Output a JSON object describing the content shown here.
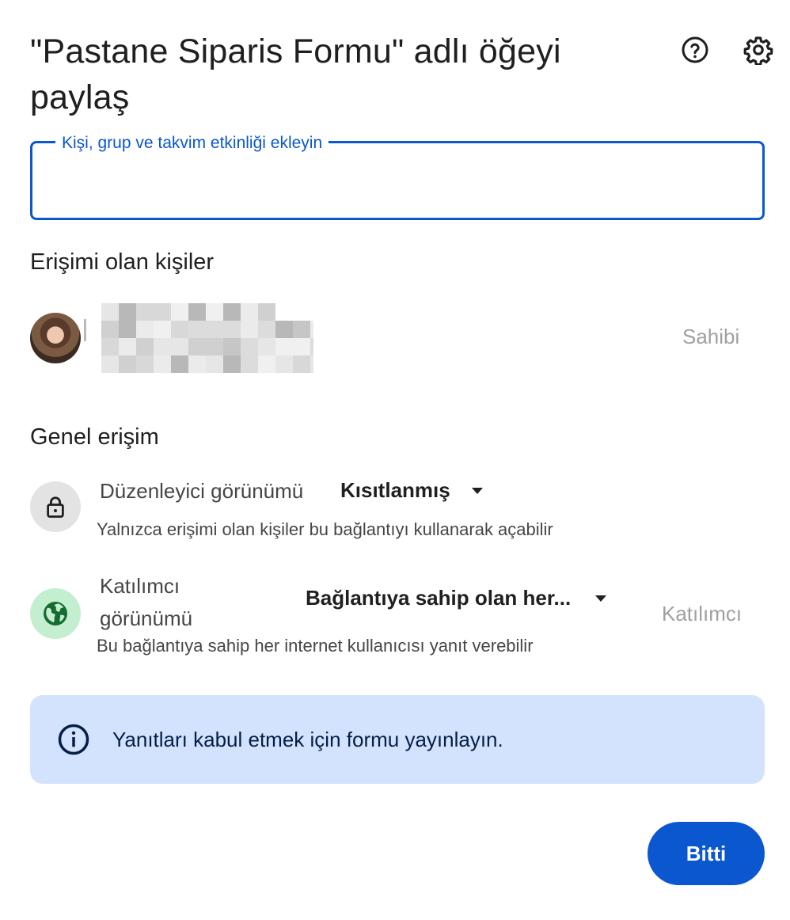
{
  "dialog": {
    "title": "\"Pastane Siparis Formu\" adlı öğeyi paylaş"
  },
  "header_icons": {
    "help": "help-circle-icon",
    "settings": "gear-icon"
  },
  "add_people": {
    "label": "Kişi, grup ve takvim etkinliği ekleyin",
    "value": ""
  },
  "people_with_access": {
    "heading": "Erişimi olan kişiler",
    "people": [
      {
        "name_email": "",
        "role": "Sahibi"
      }
    ]
  },
  "general_access": {
    "heading": "Genel erişim",
    "editor_view": {
      "label": "Düzenleyici görünümü",
      "selected": "Kısıtlanmış",
      "description": "Yalnızca erişimi olan kişiler bu bağlantıyı kullanarak açabilir",
      "icon": "lock-icon"
    },
    "participant_view": {
      "label": "Katılımcı görünümü",
      "selected": "Bağlantıya sahip olan her...",
      "role": "Katılımcı",
      "description": "Bu bağlantıya sahip her internet kullanıcısı yanıt verebilir",
      "icon": "globe-icon"
    }
  },
  "info_banner": {
    "text": "Yanıtları kabul etmek için formu yayınlayın.",
    "icon": "info-icon"
  },
  "actions": {
    "done_label": "Bitti"
  },
  "colors": {
    "primary": "#0b57d0",
    "banner_bg": "#d3e3fd",
    "globe_bg": "#c4eed0",
    "lock_bg": "#e3e3e3"
  }
}
